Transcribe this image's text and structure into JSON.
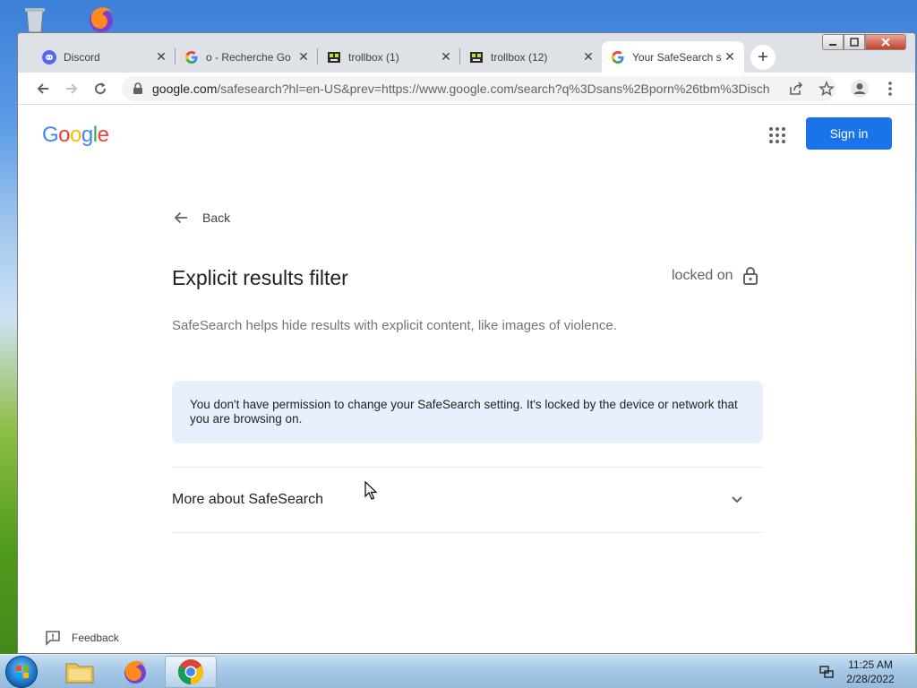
{
  "tabs": [
    {
      "title": "Discord",
      "icon": "discord-icon"
    },
    {
      "title": "o - Recherche Go",
      "icon": "google-g-icon"
    },
    {
      "title": "trollbox (1)",
      "icon": "trollbox-icon"
    },
    {
      "title": "trollbox (12)",
      "icon": "trollbox-icon"
    },
    {
      "title": "Your SafeSearch s",
      "icon": "google-g-icon",
      "active": true
    }
  ],
  "toolbar": {
    "url_host": "google.com",
    "url_rest": "/safesearch?hl=en-US&prev=https://www.google.com/search?q%3Dsans%2Bporn%26tbm%3Disch"
  },
  "page": {
    "logo": "Google",
    "sign_in": "Sign in",
    "back": "Back",
    "heading": "Explicit results filter",
    "locked_status": "locked on",
    "description": "SafeSearch helps hide results with explicit content, like images of violence.",
    "notice": "You don't have permission to change your SafeSearch setting. It's locked by the device or network that you are browsing on.",
    "more": "More about SafeSearch",
    "feedback": "Feedback"
  },
  "taskbar": {
    "time": "11:25 AM",
    "date": "2/28/2022"
  },
  "colors": {
    "accent": "#1a73e8",
    "notice_bg": "#e8f0fe",
    "google_blue": "#4285f4",
    "google_red": "#ea4335",
    "google_yellow": "#fbbc05",
    "google_green": "#34a853"
  }
}
